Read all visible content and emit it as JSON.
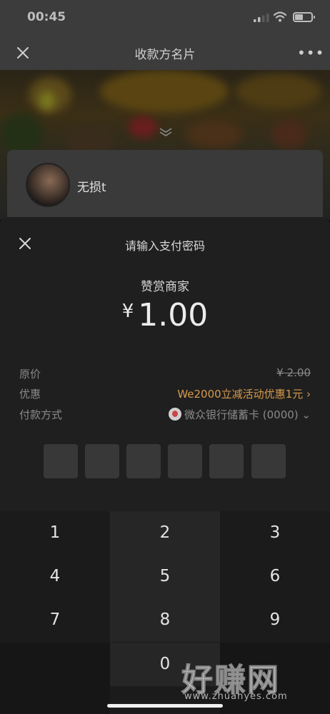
{
  "status_bar": {
    "time": "00:45"
  },
  "nav": {
    "title": "收款方名片"
  },
  "card": {
    "name": "无损t"
  },
  "sheet": {
    "title": "请输入支付密码",
    "purpose": "赞赏商家",
    "currency": "¥",
    "amount": "1.00",
    "rows": [
      {
        "label": "原价",
        "value": "¥ 2.00"
      },
      {
        "label": "优惠",
        "value": "We2000立减活动优惠1元 ›"
      },
      {
        "label": "付款方式",
        "value": "微众银行储蓄卡 (0000) ⌄"
      }
    ],
    "pin_length": 6
  },
  "keypad": {
    "keys": [
      "1",
      "2",
      "3",
      "4",
      "5",
      "6",
      "7",
      "8",
      "9",
      "",
      "0",
      ""
    ]
  },
  "watermark": {
    "main": "好赚网",
    "sub": "www.zhuanyes.com"
  },
  "colors": {
    "accent_orange": "#d79a4c",
    "sheet_bg": "#1f1f1f",
    "key_bg": "#262626"
  }
}
